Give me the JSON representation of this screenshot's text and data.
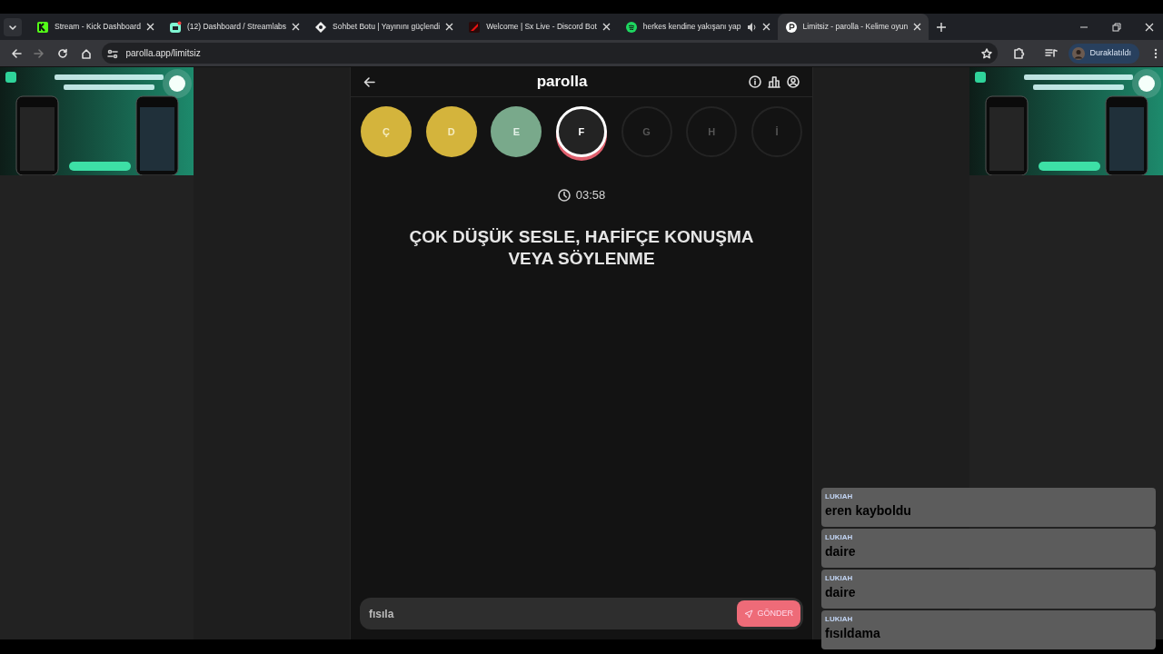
{
  "browser": {
    "tabs": [
      {
        "title": "Stream - Kick Dashboard",
        "selected": false,
        "audio": false
      },
      {
        "title": "(12) Dashboard / Streamlabs",
        "selected": false,
        "audio": false
      },
      {
        "title": "Sohbet Botu | Yayınını güçlendi",
        "selected": false,
        "audio": false
      },
      {
        "title": "Welcome | Sx Live - Discord Bot",
        "selected": false,
        "audio": false
      },
      {
        "title": "herkes kendine yakışanı yap",
        "selected": false,
        "audio": true
      },
      {
        "title": "Limitsiz - parolla - Kelime oyun",
        "selected": true,
        "audio": false
      }
    ],
    "url": "parolla.app/limitsiz",
    "profile": "Duraklatıldı"
  },
  "game": {
    "title": "parolla",
    "letters": [
      {
        "letter": "Ç",
        "kind": "wrong"
      },
      {
        "letter": "D",
        "kind": "wrong"
      },
      {
        "letter": "E",
        "kind": "correct"
      },
      {
        "letter": "F",
        "kind": "current"
      },
      {
        "letter": "G",
        "kind": "pending"
      },
      {
        "letter": "H",
        "kind": "pending"
      },
      {
        "letter": "İ",
        "kind": "pending"
      }
    ],
    "timer": "03:58",
    "question": "ÇOK DÜŞÜK SESLE, HAFİFÇE KONUŞMA VEYA SÖYLENME",
    "answer": "fısıla",
    "submit": "GÖNDER"
  },
  "chat": [
    {
      "user": "LUKIAH",
      "message": "eren kayboldu"
    },
    {
      "user": "LUKIAH",
      "message": "daire"
    },
    {
      "user": "LUKIAH",
      "message": "daire"
    },
    {
      "user": "LUKIAH",
      "message": "fısıldama"
    }
  ]
}
